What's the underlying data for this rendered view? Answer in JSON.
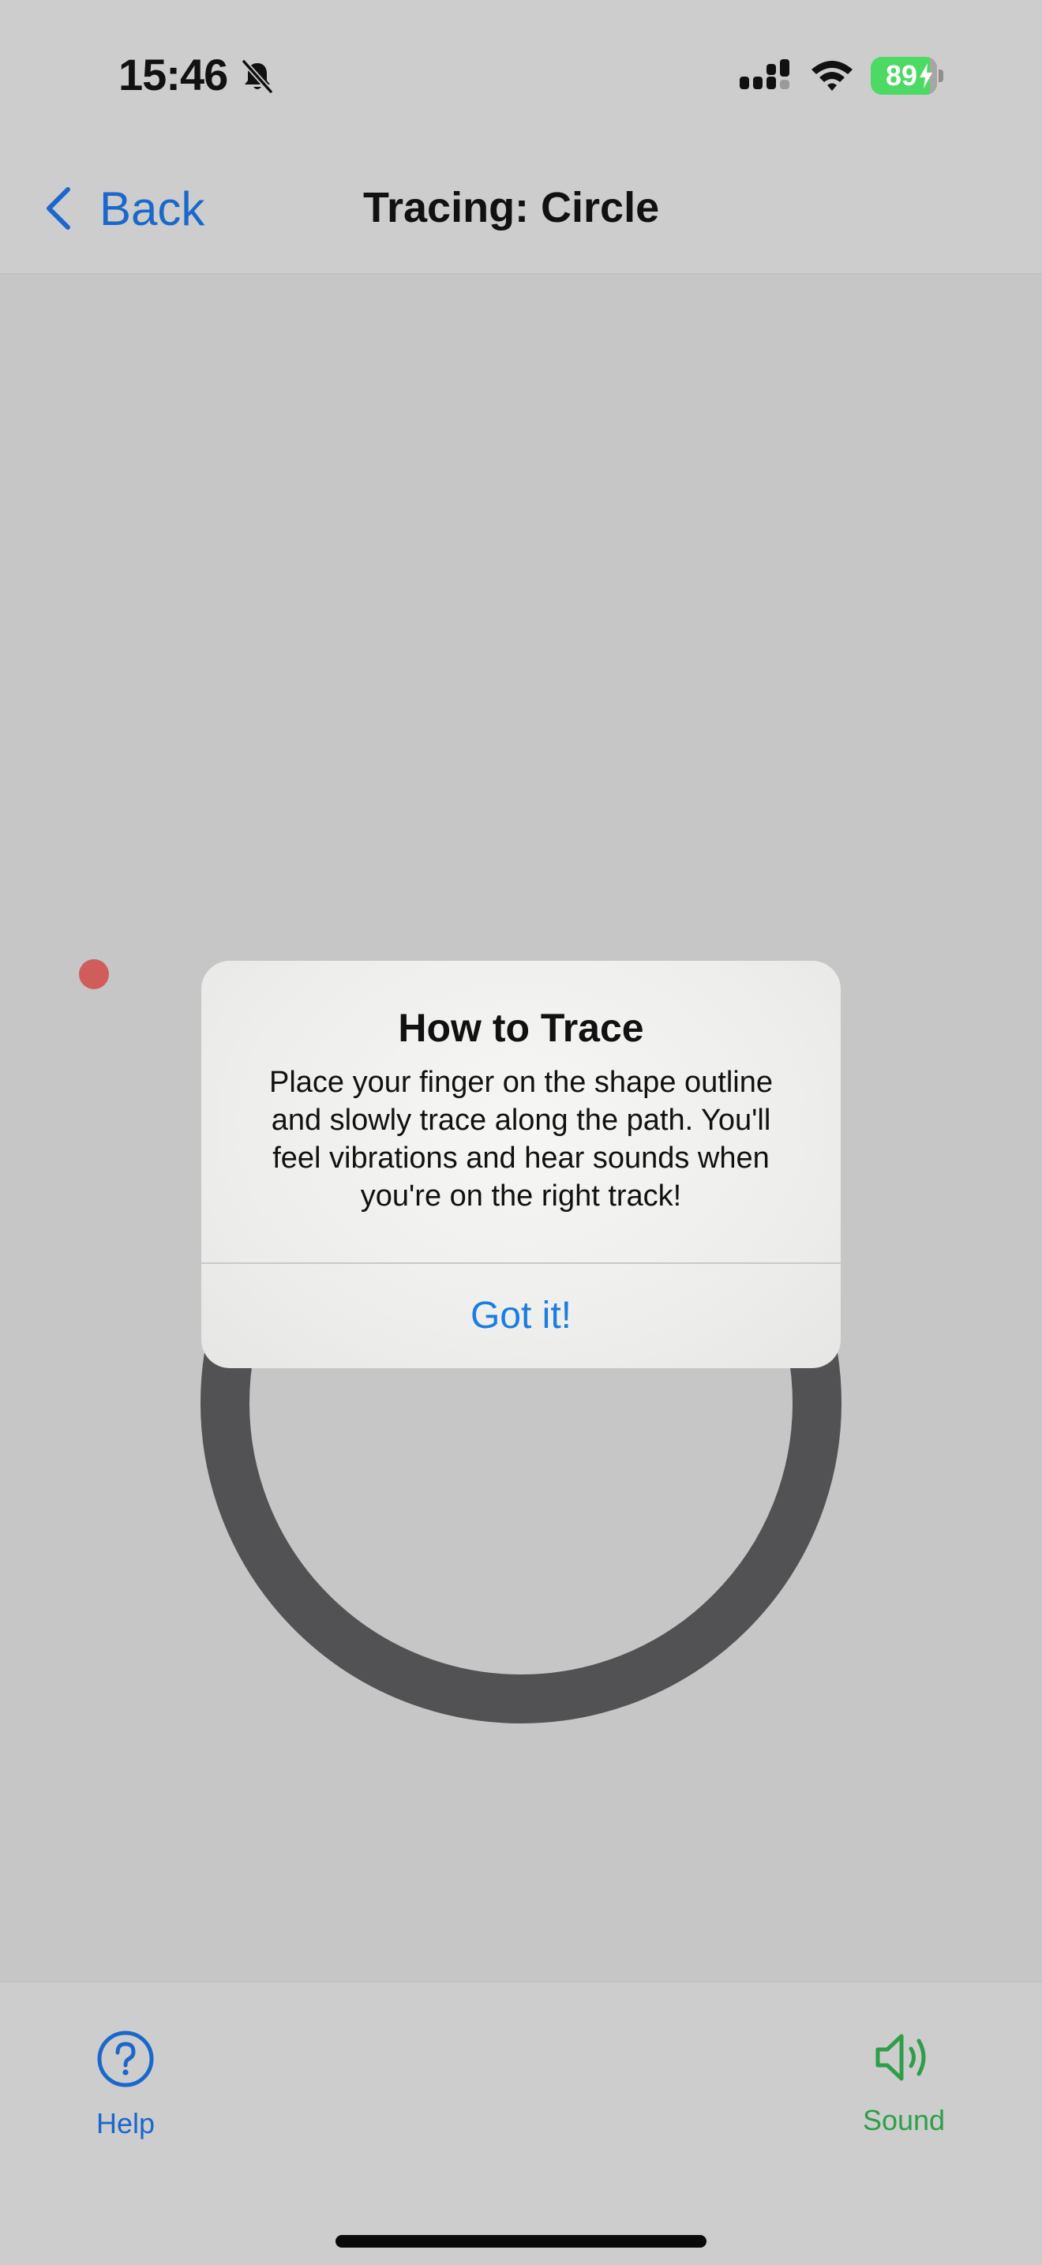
{
  "status_bar": {
    "time": "15:46",
    "battery_level": "89",
    "battery_fraction": 0.89,
    "mute_icon": "bell-slash-icon",
    "signal_icon": "cellular-signal-icon",
    "wifi_icon": "wifi-icon",
    "battery_color": "#4cd964"
  },
  "nav": {
    "back_label": "Back",
    "title": "Tracing: Circle",
    "accent_color": "#1a68cc"
  },
  "canvas": {
    "shape": "circle",
    "start_marker_color": "#d05c5c",
    "outline_color": "#525254"
  },
  "alert": {
    "title": "How to Trace",
    "message_lines": [
      "Place your finger on the shape outline",
      "and slowly trace along the path. You'll",
      "feel vibrations and hear sounds when",
      "you're on the right track!"
    ],
    "button_label": "Got it!"
  },
  "bottom_bar": {
    "help_label": "Help",
    "help_icon": "question-circle-icon",
    "sound_label": "Sound",
    "sound_icon": "speaker-wave-icon",
    "sound_color": "#2e9e4a"
  }
}
